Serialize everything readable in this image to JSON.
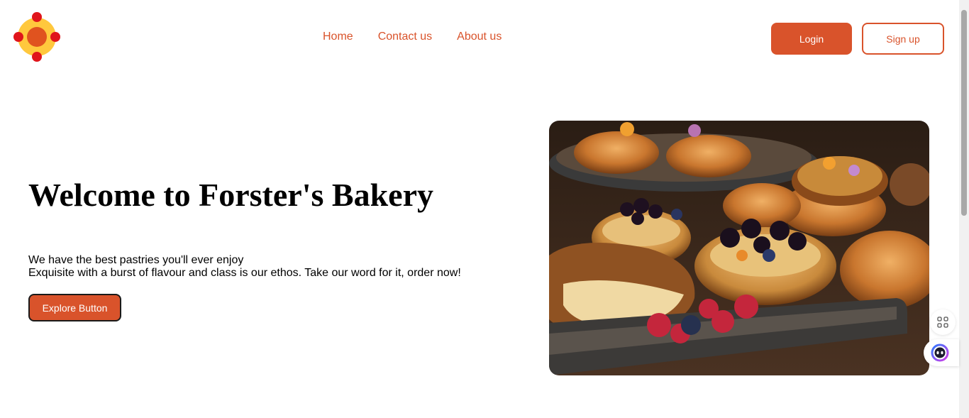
{
  "brand": {
    "logo_icon": "sun-logo-icon",
    "primary_color": "#d9532b"
  },
  "nav": {
    "home": "Home",
    "contact": "Contact us",
    "about": "About us"
  },
  "auth": {
    "login": "Login",
    "signup": "Sign up"
  },
  "hero": {
    "title": "Welcome to Forster's Bakery",
    "line1": "We have the best pastries you'll ever enjoy",
    "line2": "Exquisite with a burst of flavour and class is our ethos. Take our word for it, order now!",
    "cta": "Explore Button",
    "image_icon": "pastries-photo"
  },
  "floating": {
    "apps_icon": "apps-grid-icon",
    "assistant_icon": "assistant-face-icon"
  }
}
